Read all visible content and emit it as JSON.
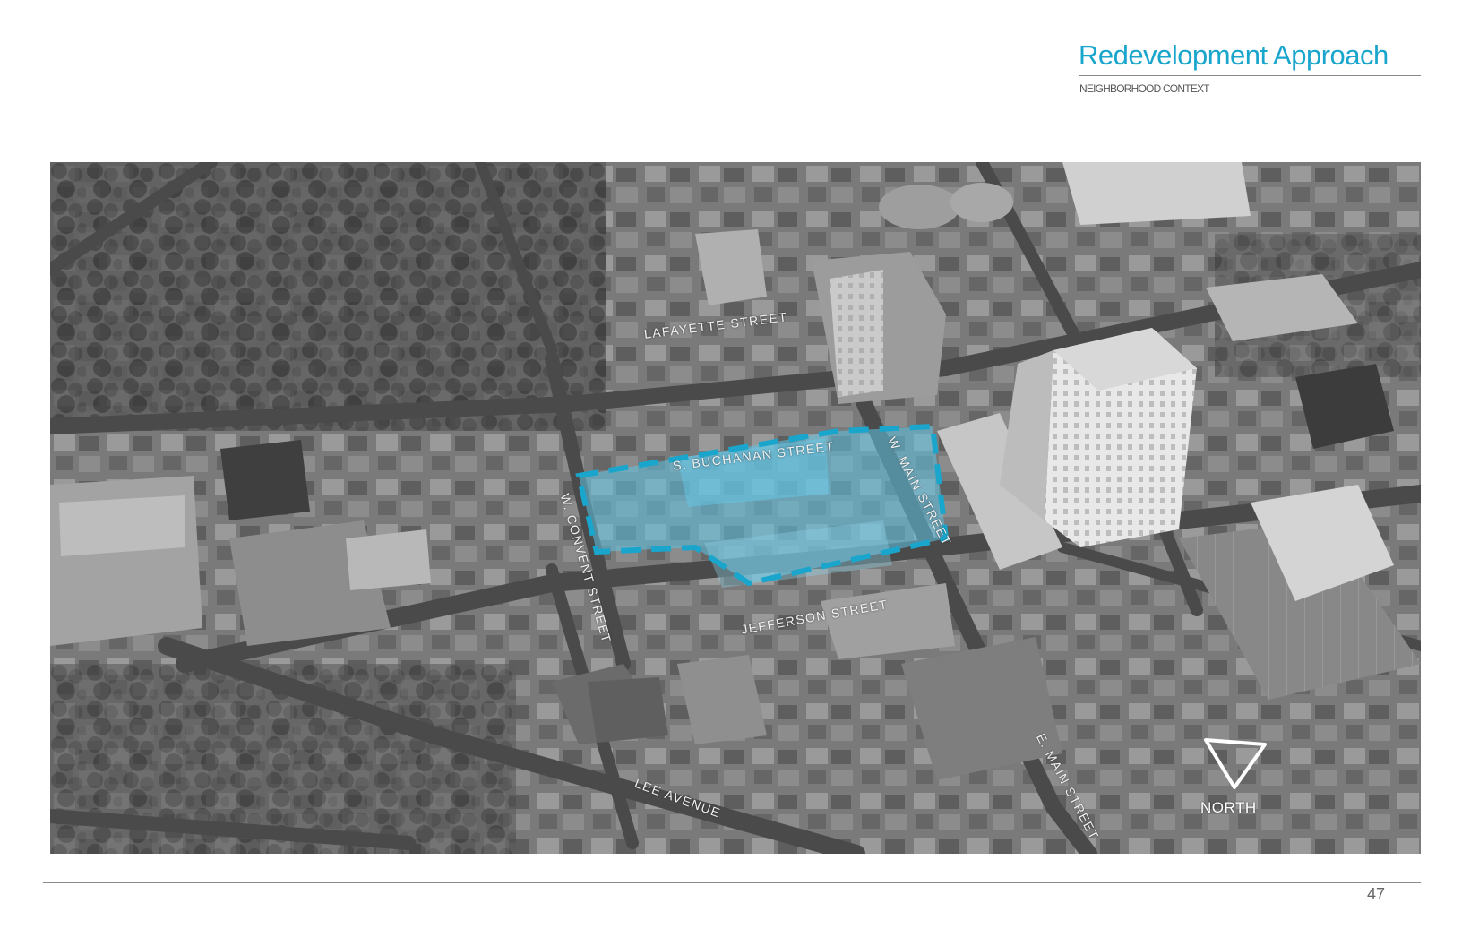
{
  "header": {
    "title": "Redevelopment Approach",
    "subtitle": "NEIGHBORHOOD CONTEXT"
  },
  "map": {
    "highlight_color": "#5fc3e4",
    "boundary_color": "#1aa6cc",
    "streets": {
      "lafayette": "LAFAYETTE STREET",
      "buchanan": "S. BUCHANAN STREET",
      "w_main": "W. MAIN STREET",
      "w_convent": "W. CONVENT STREET",
      "jefferson": "JEFFERSON STREET",
      "lee": "LEE AVENUE",
      "e_main": "E. MAIN STREET"
    },
    "north_label": "NORTH"
  },
  "footer": {
    "page_number": "47"
  }
}
